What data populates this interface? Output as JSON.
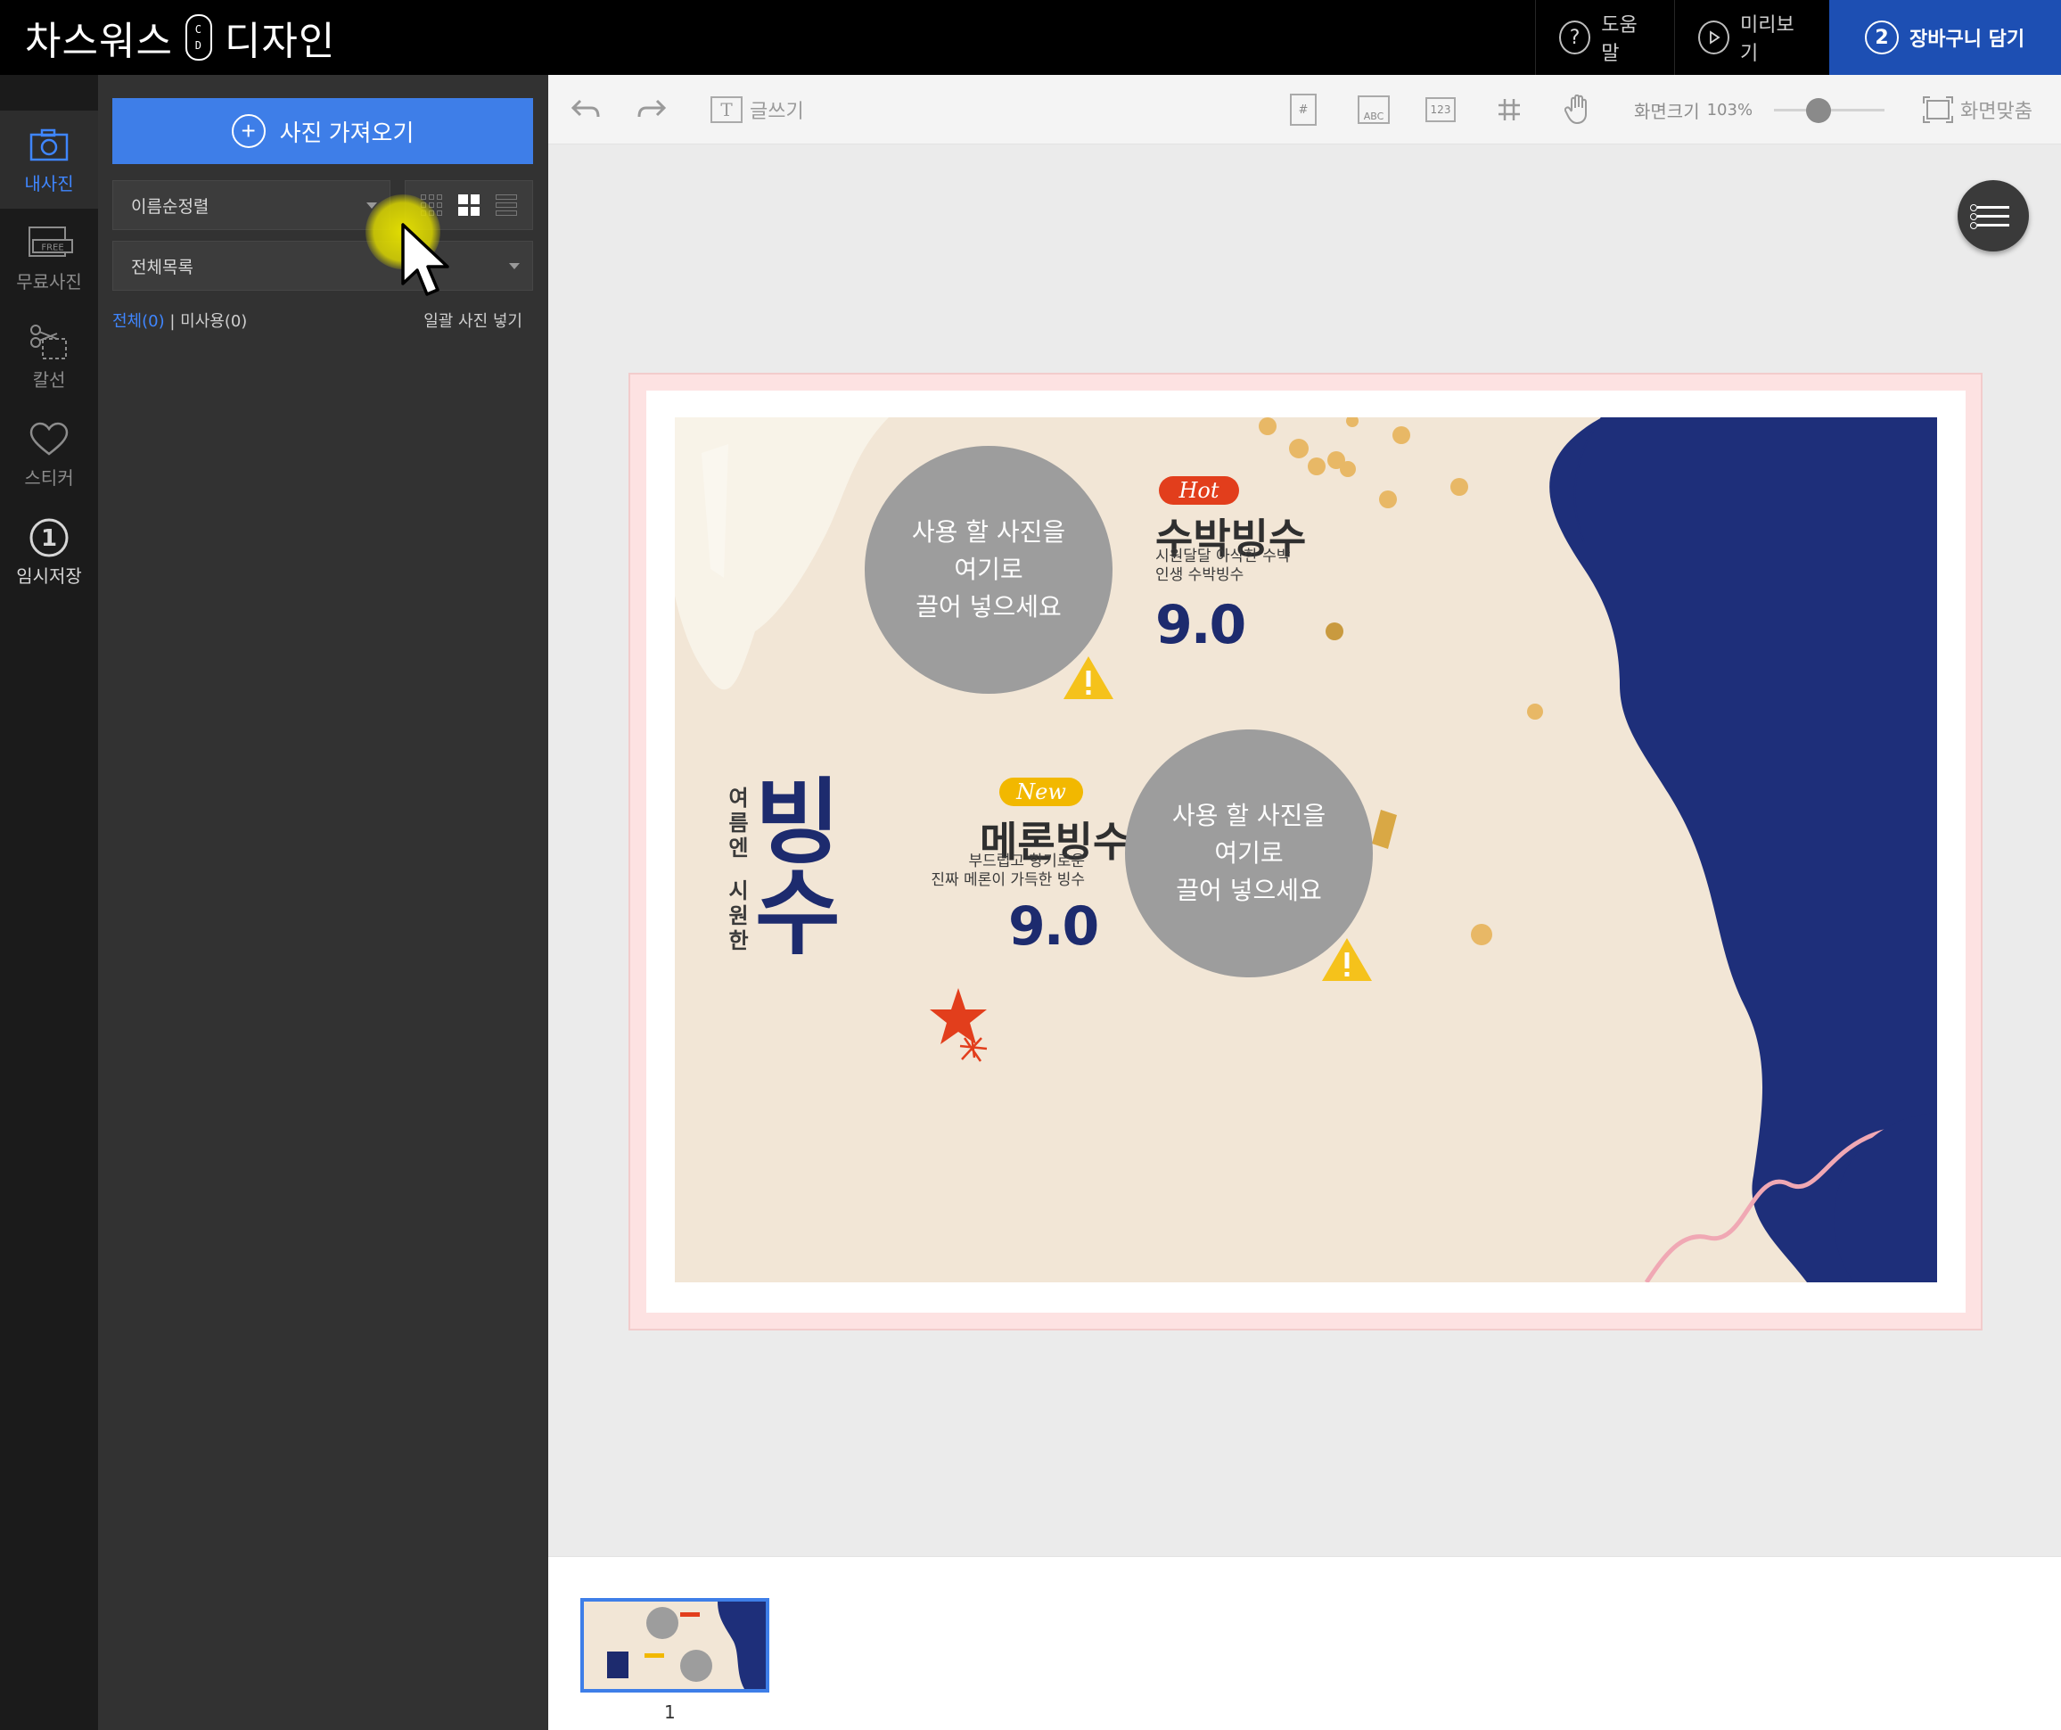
{
  "header": {
    "brand_left": "차스워스",
    "brand_badge_top": "C",
    "brand_badge_bottom": "D",
    "brand_right": "디자인",
    "help_label": "도움말",
    "help_icon": "?",
    "preview_label": "미리보기",
    "cart_step": "2",
    "cart_label": "장바구니 담기"
  },
  "rail": {
    "items": [
      {
        "label": "내사진",
        "icon": "camera-icon",
        "active": true
      },
      {
        "label": "무료사진",
        "icon": "free-photo-icon",
        "badge": "FREE"
      },
      {
        "label": "칼선",
        "icon": "scissors-icon"
      },
      {
        "label": "스티커",
        "icon": "heart-icon"
      },
      {
        "label": "임시저장",
        "icon": "temp-save-icon",
        "badge": "1"
      }
    ]
  },
  "panel": {
    "import_label": "사진 가져오기",
    "sort_value": "이름순정렬",
    "album_value": "전체목록",
    "filter_all": "전체(0)",
    "filter_sep": " | ",
    "filter_unused": "미사용(0)",
    "bulk_insert": "일괄 사진 넣기"
  },
  "toolbar": {
    "write_label": "글쓰기",
    "abc_label": "ABC",
    "num_label": "123",
    "zoom_label": "화면크기",
    "zoom_value": "103%",
    "zoom_fraction": 0.4,
    "fit_label": "화면맞춤"
  },
  "design": {
    "photo_placeholder": "사용 할 사진을\n여기로\n끌어 넣으세요",
    "hot": {
      "tag": "Hot",
      "name": "수박빙수",
      "desc": "시원달달 아삭한 수박\n인생 수박빙수",
      "price": "9.0"
    },
    "new": {
      "tag": "New",
      "name": "메론빙수",
      "desc": "부드럽고 향기로운\n진짜 메론이 가득한 빙수",
      "price": "9.0"
    },
    "vertical_1": "여름엔",
    "vertical_2": "시원한",
    "big_1": "빙",
    "big_2": "수"
  },
  "filmstrip": {
    "page_number": "1"
  },
  "colors": {
    "accent": "#3e7ee8",
    "cart": "#1d4fb3",
    "navy": "#1d2b6e",
    "hot": "#e23e1c",
    "new": "#f2b800"
  }
}
